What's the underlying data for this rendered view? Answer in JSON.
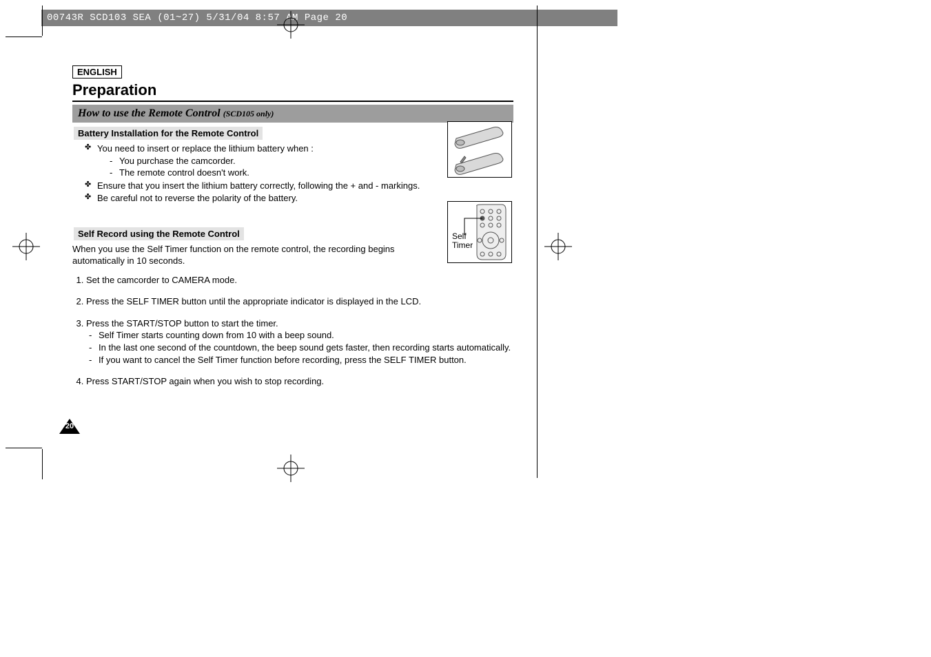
{
  "header_strip": "00743R SCD103 SEA (01~27)  5/31/04 8:57 AM  Page 20",
  "language_label": "ENGLISH",
  "chapter_title": "Preparation",
  "section_bar": {
    "title": "How to use the Remote Control",
    "suffix": "(SCD105 only)"
  },
  "battery": {
    "subhead": "Battery Installation for the Remote Control",
    "bullet1_intro": "You need to insert or replace the lithium battery when :",
    "bullet1_sub1": "You purchase the camcorder.",
    "bullet1_sub2": "The remote control doesn't work.",
    "bullet2": "Ensure that you insert the lithium battery correctly, following the + and - markings.",
    "bullet3": "Be careful not to reverse the polarity of the battery."
  },
  "selfrec": {
    "subhead": "Self Record using the Remote Control",
    "intro": "When you use the Self Timer function on the remote control, the recording begins automatically in 10 seconds.",
    "step1": "Set the camcorder to CAMERA mode.",
    "step2": "Press the SELF TIMER button until the appropriate indicator is displayed in the LCD.",
    "step3": "Press the START/STOP button to start the timer.",
    "step3_sub1": "Self Timer starts counting down from 10 with a beep sound.",
    "step3_sub2": "In the last one second of the countdown, the beep sound gets faster, then recording starts automatically.",
    "step3_sub3": "If you want to cancel the Self Timer function before recording, press the SELF TIMER button.",
    "step4": "Press START/STOP again when you wish to stop recording."
  },
  "illus2_label_line1": "Self",
  "illus2_label_line2": "Timer",
  "page_number": "20"
}
